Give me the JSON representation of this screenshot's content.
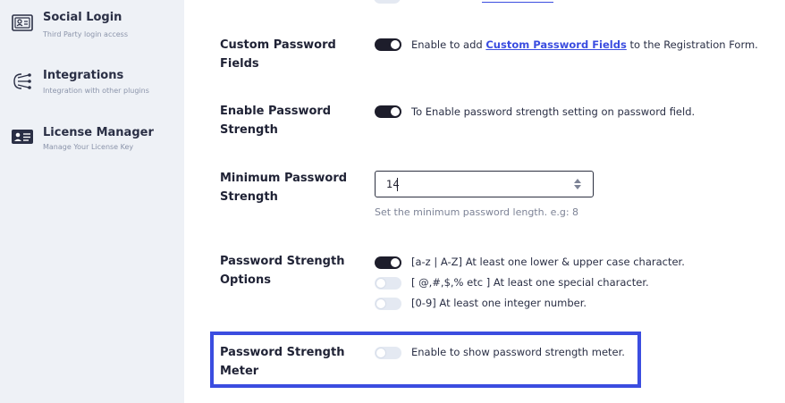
{
  "sidebar": {
    "items": [
      {
        "title": "Social Login",
        "subtitle": "Third Party login access",
        "icon": "user-card-icon"
      },
      {
        "title": "Integrations",
        "subtitle": "Integration with other plugins",
        "icon": "integrations-icon"
      },
      {
        "title": "License Manager",
        "subtitle": "Manage Your License Key",
        "icon": "license-card-icon"
      }
    ]
  },
  "settings": {
    "custom_password_fields": {
      "label": "Custom Password Fields",
      "enabled": true,
      "desc_prefix": "Enable to add ",
      "desc_link": "Custom Password Fields",
      "desc_suffix": " to the Registration Form."
    },
    "enable_password_strength": {
      "label": "Enable Password Strength",
      "enabled": true,
      "description": "To Enable password strength setting on password field."
    },
    "minimum_password_strength": {
      "label": "Minimum Password Strength",
      "value": "14",
      "helper": "Set the minimum password length. e.g: 8"
    },
    "password_strength_options": {
      "label": "Password Strength Options",
      "options": [
        {
          "text": "[a-z | A-Z] At least one lower & upper case character.",
          "enabled": true
        },
        {
          "text": "[ @,#,$,% etc ] At least one special character.",
          "enabled": false
        },
        {
          "text": "[0-9] At least one integer number.",
          "enabled": false
        }
      ]
    },
    "password_strength_meter": {
      "label": "Password Strength Meter",
      "enabled": false,
      "description": "Enable to show password strength meter."
    }
  },
  "colors": {
    "accent": "#3b4de0",
    "toggle_on": "#1d1d2b",
    "toggle_off": "#e4e9f2",
    "sidebar_bg": "#eef1f6"
  }
}
